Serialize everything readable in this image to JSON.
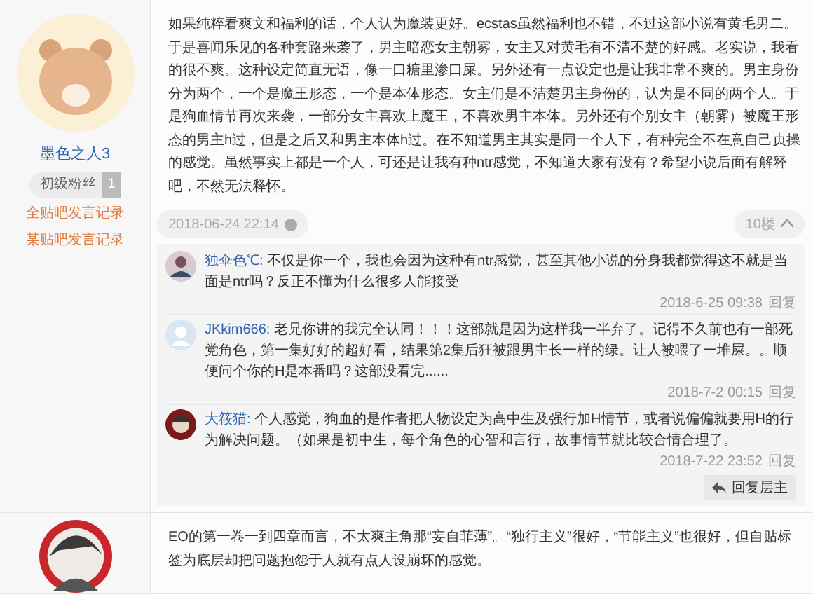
{
  "posts": [
    {
      "author": {
        "name": "墨色之人3",
        "badge": "初级粉丝",
        "level": "1",
        "links": [
          "全贴吧发言记录",
          "某贴吧发言记录"
        ]
      },
      "body": "如果纯粹看爽文和福利的话，个人认为魔装更好。ecstas虽然福利也不错，不过这部小说有黄毛男二。于是喜闻乐见的各种套路来袭了，男主暗恋女主朝雾，女主又对黄毛有不清不楚的好感。老实说，我看的很不爽。这种设定简直无语，像一口糖里渗口屎。另外还有一点设定也是让我非常不爽的。男主身份分为两个，一个是魔王形态，一个是本体形态。女主们是不清楚男主身份的，认为是不同的两个人。于是狗血情节再次来袭，一部分女主喜欢上魔王，不喜欢男主本体。另外还有个别女主（朝雾）被魔王形态的男主h过，但是之后又和男主本体h过。在不知道男主其实是同一个人下，有种完全不在意自己贞操的感觉。虽然事实上都是一个人，可还是让我有种ntr感觉，不知道大家有没有？希望小说后面有解释吧，不然无法释怀。",
      "time": "2018-06-24 22:14",
      "floor": "10楼",
      "comments": [
        {
          "name": "独伞色℃:",
          "text": "不仅是你一个，我也会因为这种有ntr感觉，甚至其他小说的分身我都觉得这不就是当面是ntr吗？反正不懂为什么很多人能接受",
          "time": "2018-6-25 09:38",
          "reply": "回复"
        },
        {
          "name": "JKkim666:",
          "text": "老兄你讲的我完全认同！！！这部就是因为这样我一半弃了。记得不久前也有一部死党角色，第一集好好的超好看，结果第2集后狂被跟男主长一样的绿。让人被喂了一堆屎。。顺便问个你的H是本番吗？这部没看完......",
          "time": "2018-7-2 00:15",
          "reply": "回复"
        },
        {
          "name": "大筱猫:",
          "text": "个人感觉，狗血的是作者把人物设定为高中生及强行加H情节，或者说偏偏就要用H的行为解决问题。（如果是初中生，每个角色的心智和言行，故事情节就比较合情合理了。",
          "time": "2018-7-22 23:52",
          "reply": "回复"
        }
      ],
      "reply_button": "回复层主"
    },
    {
      "body": "EO的第一卷一到四章而言，不太爽主角那“妄自菲薄”。“独行主义”很好，“节能主义”也很好，但自贴标签为底层却把问题抱怨于人就有点人设崩坏的感觉。"
    }
  ]
}
